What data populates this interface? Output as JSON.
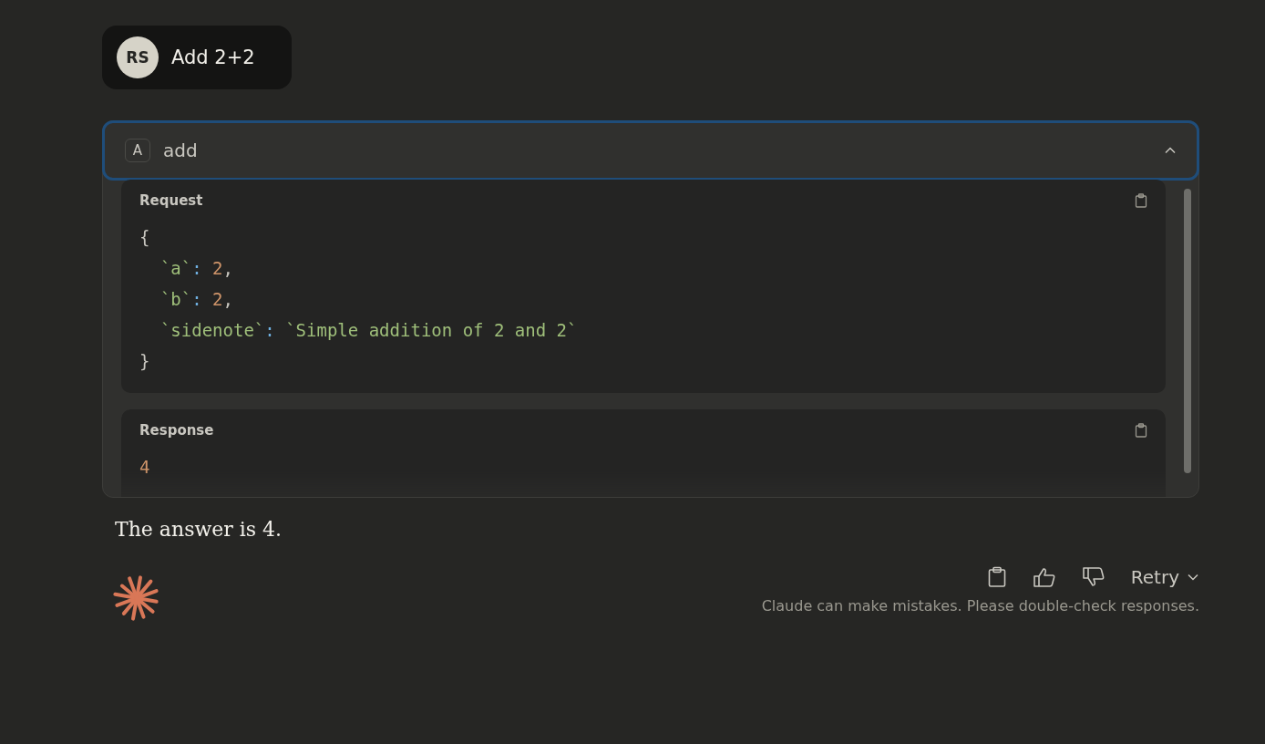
{
  "user_message": {
    "avatar": "RS",
    "text": "Add 2+2"
  },
  "tool_call": {
    "badge": "A",
    "name": "add",
    "expanded": true,
    "sections": [
      {
        "title": "Request",
        "lines": [
          [
            {
              "text": "{",
              "kind": "punct"
            }
          ],
          [
            {
              "text": "  `a`",
              "kind": "key"
            },
            {
              "text": ": ",
              "kind": "colon"
            },
            {
              "text": "2",
              "kind": "number"
            },
            {
              "text": ",",
              "kind": "punct"
            }
          ],
          [
            {
              "text": "  `b`",
              "kind": "key"
            },
            {
              "text": ": ",
              "kind": "colon"
            },
            {
              "text": "2",
              "kind": "number"
            },
            {
              "text": ",",
              "kind": "punct"
            }
          ],
          [
            {
              "text": "  `sidenote`",
              "kind": "key"
            },
            {
              "text": ": ",
              "kind": "colon"
            },
            {
              "text": "`Simple addition of 2 and 2`",
              "kind": "string"
            }
          ],
          [
            {
              "text": "}",
              "kind": "punct"
            }
          ]
        ]
      },
      {
        "title": "Response",
        "lines": [
          [
            {
              "text": "4",
              "kind": "number"
            }
          ]
        ]
      }
    ]
  },
  "answer": "The answer is 4.",
  "actions": {
    "retry": "Retry"
  },
  "disclaimer": "Claude can make mistakes. Please double-check responses."
}
